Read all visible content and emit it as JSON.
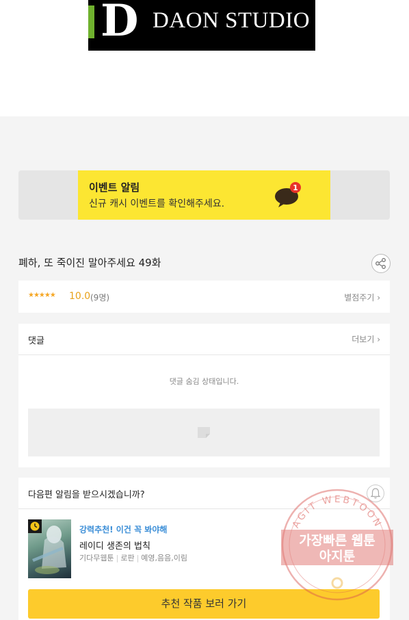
{
  "logo": {
    "letter": "D",
    "text": "DAON STUDIO"
  },
  "banner": {
    "title": "이벤트 알림",
    "subtitle": "신규 캐시 이벤트를 확인해주세요.",
    "badge_count": "1"
  },
  "episode": {
    "title": "폐하, 또 죽이진 말아주세요 49화"
  },
  "rating": {
    "stars": "★★★★★",
    "score": "10.0",
    "votes": "(9명)",
    "rate_link": "별점주기 ›"
  },
  "comments": {
    "header": "댓글",
    "more_link": "더보기 ›",
    "hidden_message": "댓글 숨김 상태입니다."
  },
  "next_episode": {
    "question": "다음편 알림을 받으시겠습니까?",
    "recommend_label": "강력추천! 이건 꼭 봐야해",
    "recommend_title": "레이디 생존의 법칙",
    "tags": [
      "기다무웹툰",
      "로판",
      "예영,음음,이림"
    ],
    "cta_label": "추천 작품 보러 가기"
  },
  "watermark": {
    "arc_text": "AGIT WEBTOON",
    "line1": "가장빠른 웹툰",
    "line2": "아지툰"
  },
  "colors": {
    "banner_yellow": "#fce632",
    "cta_yellow": "#fdcb2c",
    "star_orange": "#f5a623",
    "link_blue": "#3b8ed7",
    "badge_red": "#e8332a",
    "watermark_red": "#d9534f"
  }
}
